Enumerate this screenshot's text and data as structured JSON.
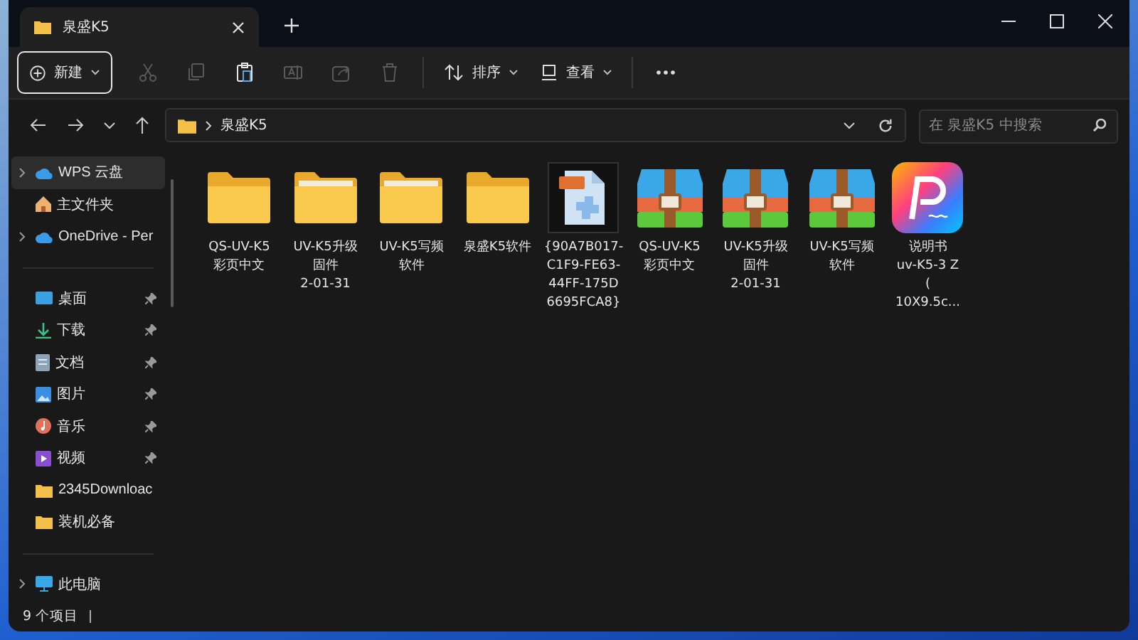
{
  "window": {
    "tab_title": "泉盛K5"
  },
  "toolbar": {
    "new_label": "新建",
    "actions": [
      {
        "kind": "cut",
        "disabled": true
      },
      {
        "kind": "copy",
        "disabled": true
      },
      {
        "kind": "paste",
        "disabled": false
      },
      {
        "kind": "rename",
        "disabled": true
      },
      {
        "kind": "share",
        "disabled": true
      },
      {
        "kind": "delete",
        "disabled": true
      }
    ],
    "sort_label": "排序",
    "view_label": "查看"
  },
  "address": {
    "crumb": "泉盛K5",
    "search_placeholder": "在 泉盛K5 中搜索"
  },
  "sidebar": {
    "groups": [
      [
        {
          "label": "WPS 云盘",
          "kind": "cloud",
          "expandable": true,
          "pinned": false,
          "selected": true
        },
        {
          "label": "主文件夹",
          "kind": "home",
          "expandable": false,
          "pinned": false,
          "selected": false
        },
        {
          "label": "OneDrive - Per",
          "kind": "cloud",
          "expandable": true,
          "pinned": false,
          "selected": false
        }
      ],
      [
        {
          "label": "桌面",
          "kind": "desktop",
          "expandable": false,
          "pinned": true,
          "selected": false
        },
        {
          "label": "下载",
          "kind": "download",
          "expandable": false,
          "pinned": true,
          "selected": false
        },
        {
          "label": "文档",
          "kind": "document",
          "expandable": false,
          "pinned": true,
          "selected": false
        },
        {
          "label": "图片",
          "kind": "picture",
          "expandable": false,
          "pinned": true,
          "selected": false
        },
        {
          "label": "音乐",
          "kind": "music",
          "expandable": false,
          "pinned": true,
          "selected": false
        },
        {
          "label": "视频",
          "kind": "video",
          "expandable": false,
          "pinned": true,
          "selected": false
        },
        {
          "label": "2345Downloac",
          "kind": "folder",
          "expandable": false,
          "pinned": false,
          "selected": false
        },
        {
          "label": "装机必备",
          "kind": "folder",
          "expandable": false,
          "pinned": false,
          "selected": false
        }
      ],
      [
        {
          "label": "此电脑",
          "kind": "pc",
          "expandable": true,
          "pinned": false,
          "selected": false
        }
      ]
    ]
  },
  "files": [
    {
      "kind": "folder",
      "name_lines": [
        "QS-UV-K5",
        "彩页中文"
      ]
    },
    {
      "kind": "folder-filled",
      "name_lines": [
        "UV-K5升级",
        "固件",
        "2-01-31"
      ]
    },
    {
      "kind": "folder-filled",
      "name_lines": [
        "UV-K5写频",
        "软件"
      ]
    },
    {
      "kind": "folder",
      "name_lines": [
        "泉盛K5软件"
      ]
    },
    {
      "kind": "png",
      "name_lines": [
        "{90A7B017-",
        "C1F9-FE63-",
        "44FF-175D",
        "6695FCA8}"
      ]
    },
    {
      "kind": "archive",
      "name_lines": [
        "QS-UV-K5",
        "彩页中文"
      ]
    },
    {
      "kind": "archive",
      "name_lines": [
        "UV-K5升级",
        "固件",
        "2-01-31"
      ]
    },
    {
      "kind": "archive",
      "name_lines": [
        "UV-K5写频",
        "软件"
      ]
    },
    {
      "kind": "pdf-app",
      "name_lines": [
        "说明书",
        "uv-K5-3 Z",
        "(",
        "10X9.5c..."
      ]
    }
  ],
  "status_bar": {
    "count": "9 个项目"
  }
}
